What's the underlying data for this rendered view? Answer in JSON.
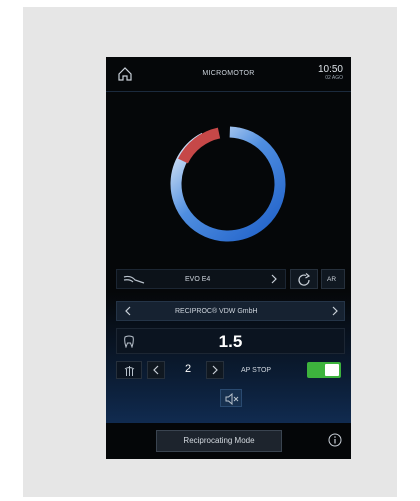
{
  "header": {
    "home_icon": "home-icon",
    "title": "MICROMOTOR",
    "time": "10:50",
    "date": "02 AGO"
  },
  "gauge": {
    "description_colors": {
      "ring_start": "#2a6fd6",
      "ring_end": "#ffffff",
      "warning_arc": "#c84a4a"
    }
  },
  "handpiece": {
    "icon": "handpiece-icon",
    "name": "EVO E4",
    "next_icon": "chevron-right-icon",
    "rotation_icon": "rotate-icon",
    "ar_label": "AR"
  },
  "file_system": {
    "prev_icon": "chevron-left-icon",
    "name": "RECIPROC® VDW GmbH",
    "next_icon": "chevron-right-icon"
  },
  "file_size": {
    "tooth_icon": "tooth-icon",
    "value": "1.5"
  },
  "apex": {
    "icon": "apex-icon",
    "prev_icon": "chevron-left-icon",
    "value": "2",
    "next_icon": "chevron-right-icon",
    "ap_stop_label": "AP STOP",
    "ap_stop_on": true,
    "toggle_color": "#3db33d"
  },
  "sound": {
    "icon": "mute-icon"
  },
  "footer": {
    "mode_label": "Reciprocating Mode",
    "info_icon": "info-icon"
  }
}
